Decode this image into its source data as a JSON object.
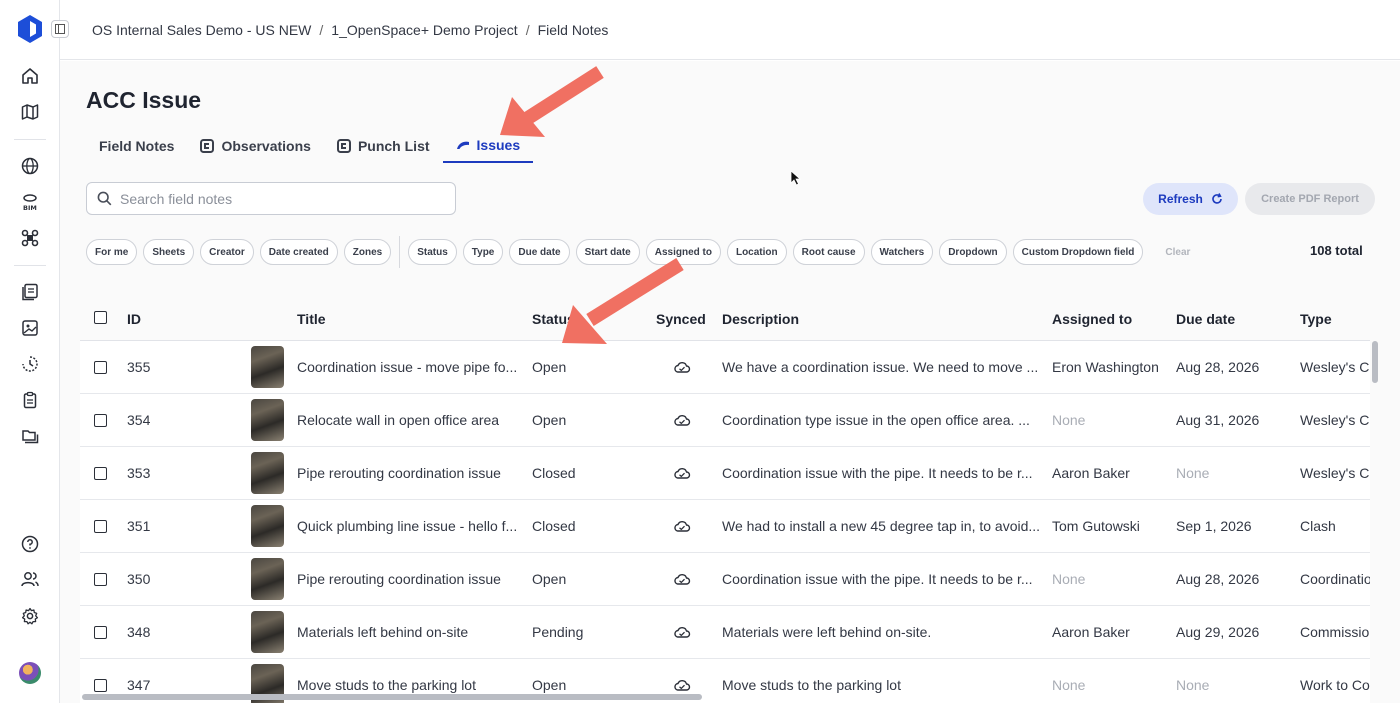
{
  "breadcrumb": [
    "OS Internal Sales Demo - US NEW",
    "1_OpenSpace+ Demo Project",
    "Field Notes"
  ],
  "breadcrumb_separator": "/",
  "page_title": "ACC Issue",
  "tabs": [
    {
      "label": "Field Notes",
      "icon": "none",
      "active": false
    },
    {
      "label": "Observations",
      "icon": "acc-icon",
      "active": false
    },
    {
      "label": "Punch List",
      "icon": "acc-icon",
      "active": false
    },
    {
      "label": "Issues",
      "icon": "procore-icon",
      "active": true
    }
  ],
  "search": {
    "placeholder": "Search field notes",
    "value": ""
  },
  "buttons": {
    "refresh": "Refresh",
    "create_pdf": "Create PDF Report"
  },
  "filters_left": [
    "For me",
    "Sheets",
    "Creator",
    "Date created",
    "Zones"
  ],
  "filters_right": [
    "Status",
    "Type",
    "Due date",
    "Start date",
    "Assigned to",
    "Location",
    "Root cause",
    "Watchers",
    "Dropdown",
    "Custom Dropdown field"
  ],
  "clear_label": "Clear",
  "total": "108 total",
  "columns": [
    "ID",
    "Title",
    "Status",
    "Synced",
    "Description",
    "Assigned to",
    "Due date",
    "Type"
  ],
  "rows": [
    {
      "id": "355",
      "title": "Coordination issue - move pipe fo...",
      "status": "Open",
      "description": "We have a coordination issue. We need to move ...",
      "assigned": "Eron Washington",
      "due": "Aug 28, 2026",
      "type": "Wesley's C"
    },
    {
      "id": "354",
      "title": "Relocate wall in open office area",
      "status": "Open",
      "description": "Coordination type issue in the open office area. ...",
      "assigned": "None",
      "due": "Aug 31, 2026",
      "type": "Wesley's C"
    },
    {
      "id": "353",
      "title": "Pipe rerouting coordination issue",
      "status": "Closed",
      "description": "Coordination issue with the pipe. It needs to be r...",
      "assigned": "Aaron Baker",
      "due": "None",
      "type": "Wesley's C"
    },
    {
      "id": "351",
      "title": "Quick plumbing line issue - hello f...",
      "status": "Closed",
      "description": "We had to install a new 45 degree tap in, to avoid...",
      "assigned": "Tom Gutowski",
      "due": "Sep 1, 2026",
      "type": "Clash"
    },
    {
      "id": "350",
      "title": "Pipe rerouting coordination issue",
      "status": "Open",
      "description": "Coordination issue with the pipe. It needs to be r...",
      "assigned": "None",
      "due": "Aug 28, 2026",
      "type": "Coordinatio"
    },
    {
      "id": "348",
      "title": "Materials left behind on-site",
      "status": "Pending",
      "description": "Materials were left behind on-site.",
      "assigned": "Aaron Baker",
      "due": "Aug 29, 2026",
      "type": "Commissio"
    },
    {
      "id": "347",
      "title": "Move studs to the parking lot",
      "status": "Open",
      "description": "Move studs to the parking lot",
      "assigned": "None",
      "due": "None",
      "type": "Work to Co"
    }
  ],
  "colors": {
    "accent": "#1d3bbf",
    "arrow": "#f07062",
    "refresh_bg": "#dfe5fa"
  }
}
